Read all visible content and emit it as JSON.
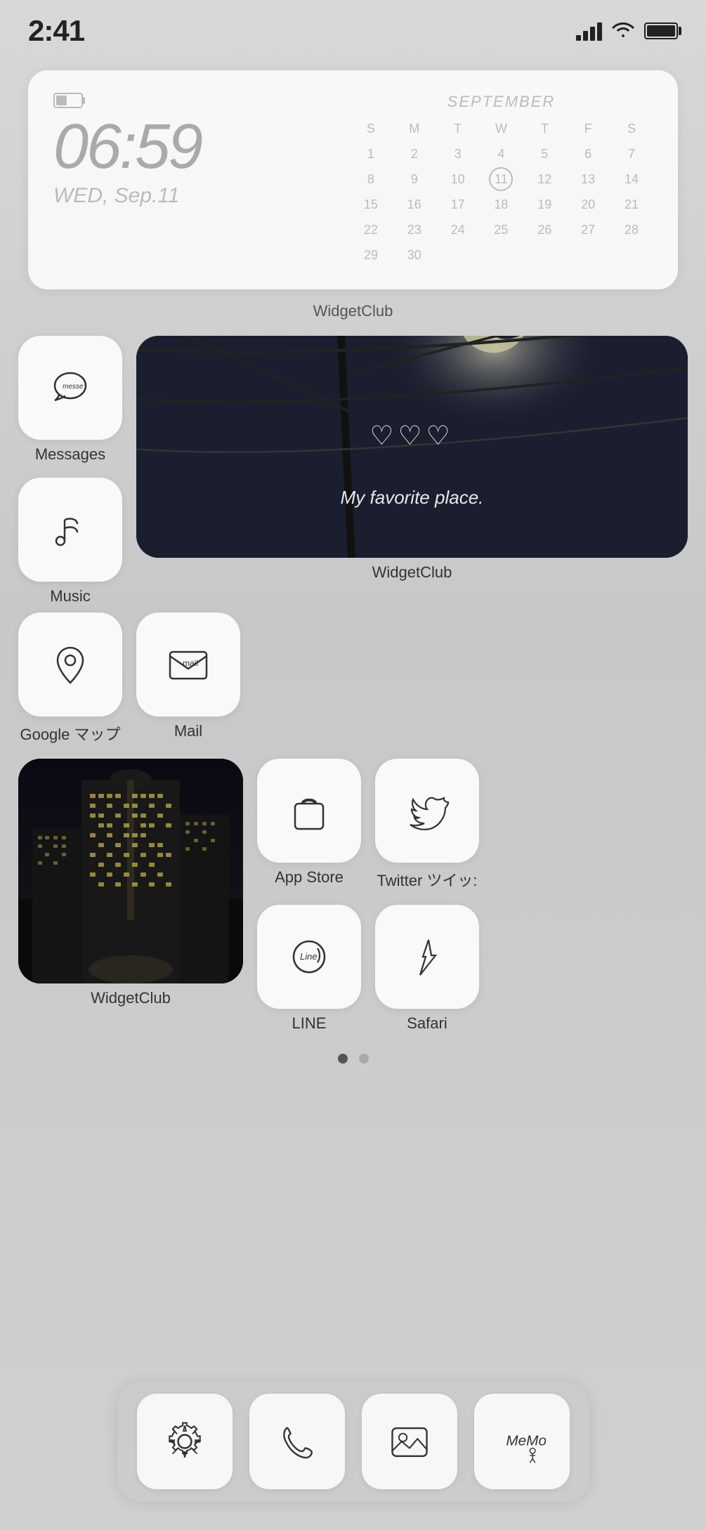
{
  "statusBar": {
    "time": "2:41",
    "battery": "full"
  },
  "widget": {
    "time": "06:59",
    "date": "WED, Sep.11",
    "month": "SEPTEMBER",
    "calHeaders": [
      "S",
      "M",
      "T",
      "W",
      "T",
      "F",
      "S"
    ],
    "calRows": [
      [
        "1",
        "2",
        "3",
        "4",
        "5",
        "6",
        "7"
      ],
      [
        "8",
        "9",
        "10",
        "11",
        "12",
        "13",
        "14"
      ],
      [
        "15",
        "16",
        "17",
        "18",
        "19",
        "20",
        "21"
      ],
      [
        "22",
        "23",
        "24",
        "25",
        "26",
        "27",
        "28"
      ],
      [
        "29",
        "30",
        "",
        "",
        "",
        "",
        ""
      ]
    ],
    "today": "11",
    "label": "WidgetClub"
  },
  "apps": {
    "row1": [
      {
        "id": "messages",
        "label": "Messages"
      },
      {
        "id": "music",
        "label": "Music"
      },
      {
        "id": "google-maps",
        "label": "Google マップ"
      },
      {
        "id": "mail",
        "label": "Mail"
      }
    ],
    "widgetclub1Label": "WidgetClub",
    "row2Left": "WidgetClub",
    "row2Right": [
      {
        "id": "app-store",
        "label": "App Store"
      },
      {
        "id": "twitter",
        "label": "Twitter ツイッ:"
      },
      {
        "id": "line",
        "label": "LINE"
      },
      {
        "id": "safari",
        "label": "Safari"
      }
    ]
  },
  "dock": [
    {
      "id": "settings",
      "label": "Settings"
    },
    {
      "id": "phone",
      "label": "Phone"
    },
    {
      "id": "photos",
      "label": "Photos"
    },
    {
      "id": "memo",
      "label": "Memo"
    }
  ],
  "pageDots": {
    "active": 0,
    "count": 2
  }
}
